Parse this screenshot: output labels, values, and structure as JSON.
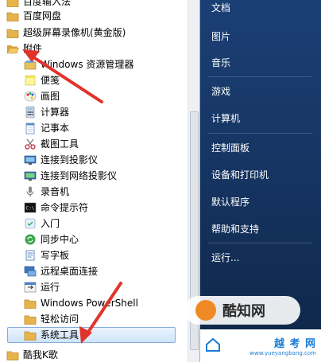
{
  "programs": {
    "folders_top": [
      {
        "label": "百度输入法"
      },
      {
        "label": "百度网盘"
      },
      {
        "label": "超级屏幕录像机(黄金版)"
      },
      {
        "label": "附件"
      }
    ],
    "accessories": [
      {
        "label": "Windows 资源管理器",
        "icon": "explorer-icon"
      },
      {
        "label": "便笺",
        "icon": "sticky-notes-icon"
      },
      {
        "label": "画图",
        "icon": "paint-icon"
      },
      {
        "label": "计算器",
        "icon": "calculator-icon"
      },
      {
        "label": "记事本",
        "icon": "notepad-icon"
      },
      {
        "label": "截图工具",
        "icon": "snipping-tool-icon"
      },
      {
        "label": "连接到投影仪",
        "icon": "projector-icon"
      },
      {
        "label": "连接到网络投影仪",
        "icon": "network-projector-icon"
      },
      {
        "label": "录音机",
        "icon": "sound-recorder-icon"
      },
      {
        "label": "命令提示符",
        "icon": "command-prompt-icon"
      },
      {
        "label": "入门",
        "icon": "getting-started-icon"
      },
      {
        "label": "同步中心",
        "icon": "sync-center-icon"
      },
      {
        "label": "写字板",
        "icon": "wordpad-icon"
      },
      {
        "label": "远程桌面连接",
        "icon": "remote-desktop-icon"
      },
      {
        "label": "运行",
        "icon": "run-icon"
      },
      {
        "label": "Windows PowerShell",
        "icon": "folder-icon"
      },
      {
        "label": "轻松访问",
        "icon": "folder-icon"
      },
      {
        "label": "系统工具",
        "icon": "folder-icon"
      }
    ],
    "folder_bottom": {
      "label": "酷我K歌"
    }
  },
  "right_menu": [
    {
      "label": "文档"
    },
    {
      "label": "图片"
    },
    {
      "label": "音乐"
    },
    {
      "label": "游戏"
    },
    {
      "label": "计算机"
    },
    {
      "label": "控制面板"
    },
    {
      "label": "设备和打印机"
    },
    {
      "label": "默认程序"
    },
    {
      "label": "帮助和支持"
    },
    {
      "label": "运行..."
    }
  ],
  "watermark": {
    "site_name": "酷知网",
    "brand": "越 考 网",
    "url": "www.yueyangbang.com"
  },
  "colors": {
    "arrow": "#e0342b",
    "folder": "#e8b44a",
    "right_panel": "#163563"
  }
}
